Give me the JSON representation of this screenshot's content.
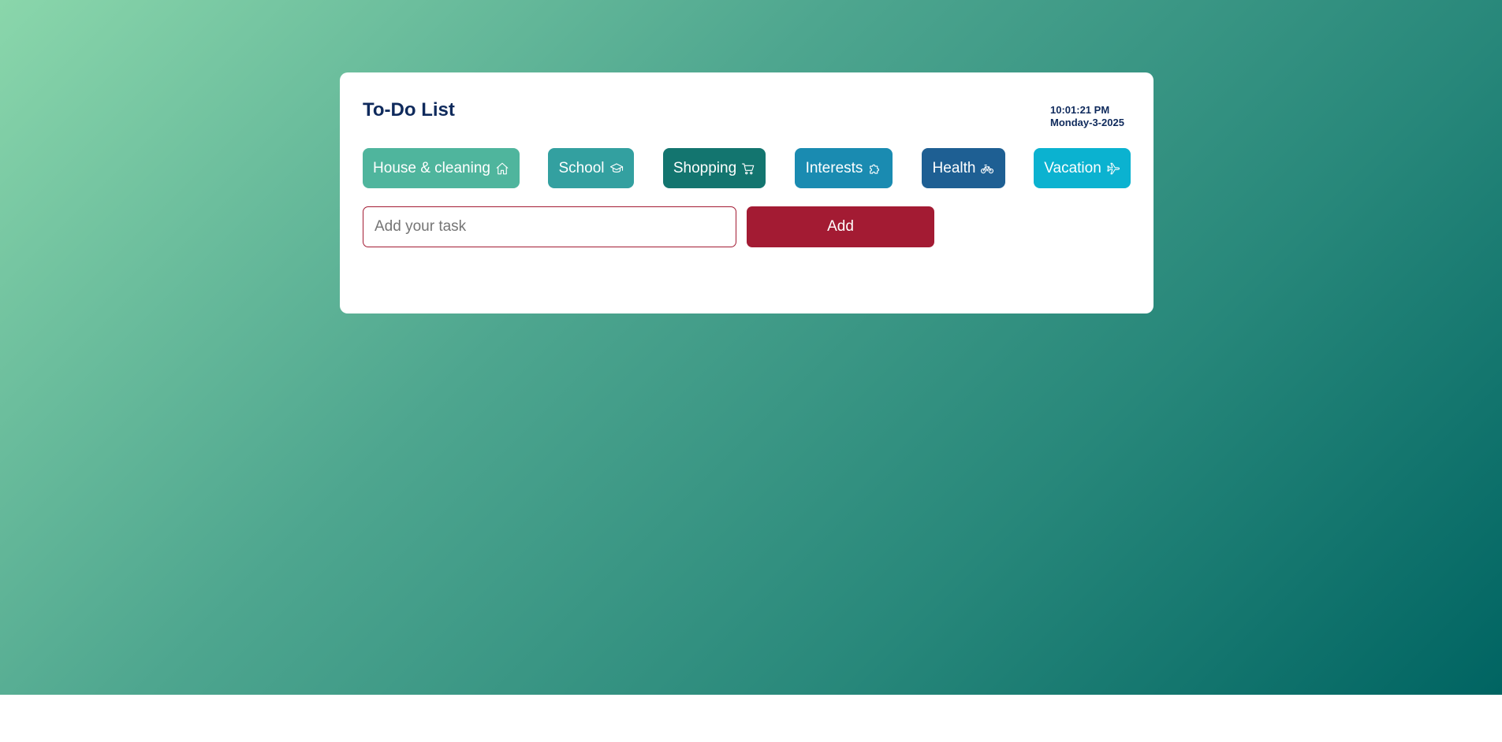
{
  "app": {
    "title": "To-Do List"
  },
  "clock": {
    "time": "10:01:21 PM",
    "date": "Monday-3-2025"
  },
  "categories": [
    {
      "label": "House & cleaning",
      "icon": "house-icon",
      "color": "#4fb59d"
    },
    {
      "label": "School",
      "icon": "graduation-cap-icon",
      "color": "#33a0a0"
    },
    {
      "label": "Shopping",
      "icon": "shopping-cart-icon",
      "color": "#13756f"
    },
    {
      "label": "Interests",
      "icon": "puzzle-icon",
      "color": "#1a8bb1"
    },
    {
      "label": "Health",
      "icon": "bicycle-icon",
      "color": "#1e5f93"
    },
    {
      "label": "Vacation",
      "icon": "airplane-icon",
      "color": "#0bb2d0"
    }
  ],
  "task_input": {
    "placeholder": "Add your task",
    "value": ""
  },
  "add_button": {
    "label": "Add",
    "color": "#a31b33"
  },
  "colors": {
    "heading": "#0f2a5c",
    "card_background": "#ffffff",
    "gradient_start": "#8ad6ab",
    "gradient_end": "#006462"
  }
}
